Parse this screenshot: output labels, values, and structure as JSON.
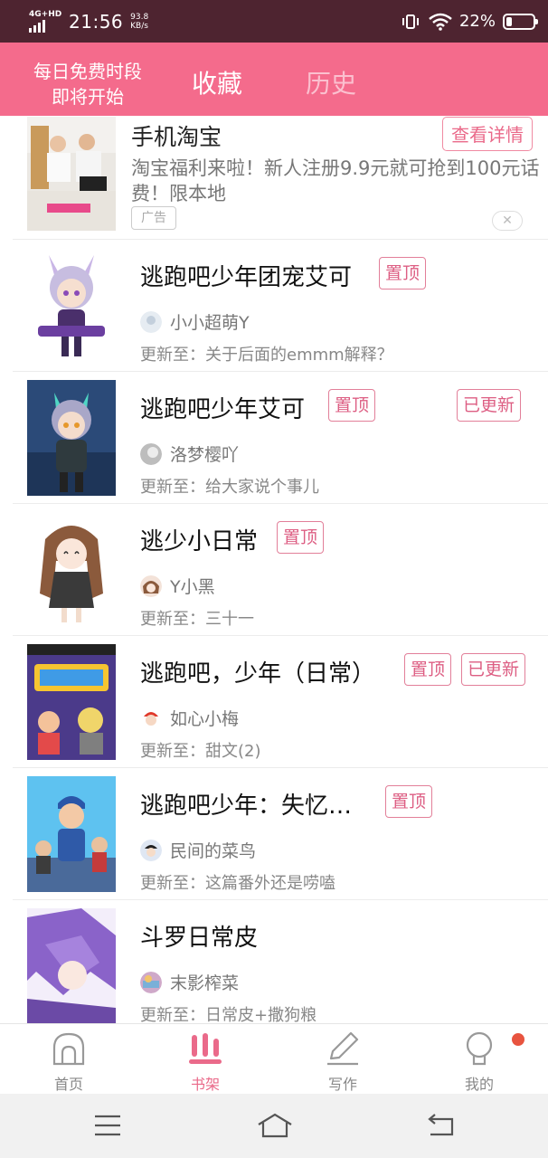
{
  "status_bar": {
    "network": "4G+HD",
    "time": "21:56",
    "speed_value": "93.8",
    "speed_unit": "KB/s",
    "battery": "22%",
    "battery_level": 0.22
  },
  "header": {
    "promo_line1": "每日免费时段",
    "promo_line2": "即将开始",
    "tab_favorites": "收藏",
    "tab_history": "历史"
  },
  "ad": {
    "title": "手机淘宝",
    "button": "查看详情",
    "description": "淘宝福利来啦！新人注册9.9元就可抢到100元话费！限本地",
    "tag": "广告",
    "close": "✕"
  },
  "books": [
    {
      "title": "逃跑吧少年团宠艾可",
      "author": "小小超萌Y",
      "update": "更新至：关于后面的emmm解释？",
      "pinned": "置顶",
      "updated": ""
    },
    {
      "title": "逃跑吧少年艾可",
      "author": "洛梦樱吖",
      "update": "更新至：给大家说个事儿",
      "pinned": "置顶",
      "updated": "已更新"
    },
    {
      "title": "逃少小日常",
      "author": "Y小黑",
      "update": "更新至：三十一",
      "pinned": "置顶",
      "updated": ""
    },
    {
      "title": "逃跑吧，少年（日常）",
      "author": "如心小梅",
      "update": "更新至：甜文(2)",
      "pinned": "置顶",
      "updated": "已更新"
    },
    {
      "title": "逃跑吧少年：失忆…",
      "author": "民间的菜鸟",
      "update": "更新至：这篇番外还是唠嗑",
      "pinned": "置顶",
      "updated": ""
    },
    {
      "title": "斗罗日常皮",
      "author": "末影榨菜",
      "update": "更新至：日常皮+撒狗粮",
      "pinned": "",
      "updated": ""
    }
  ],
  "nav": {
    "home": "首页",
    "shelf": "书架",
    "write": "写作",
    "me": "我的"
  },
  "colors": {
    "accent": "#f46b8c",
    "status_bar": "#4e2430",
    "badge": "#dd5e83"
  }
}
